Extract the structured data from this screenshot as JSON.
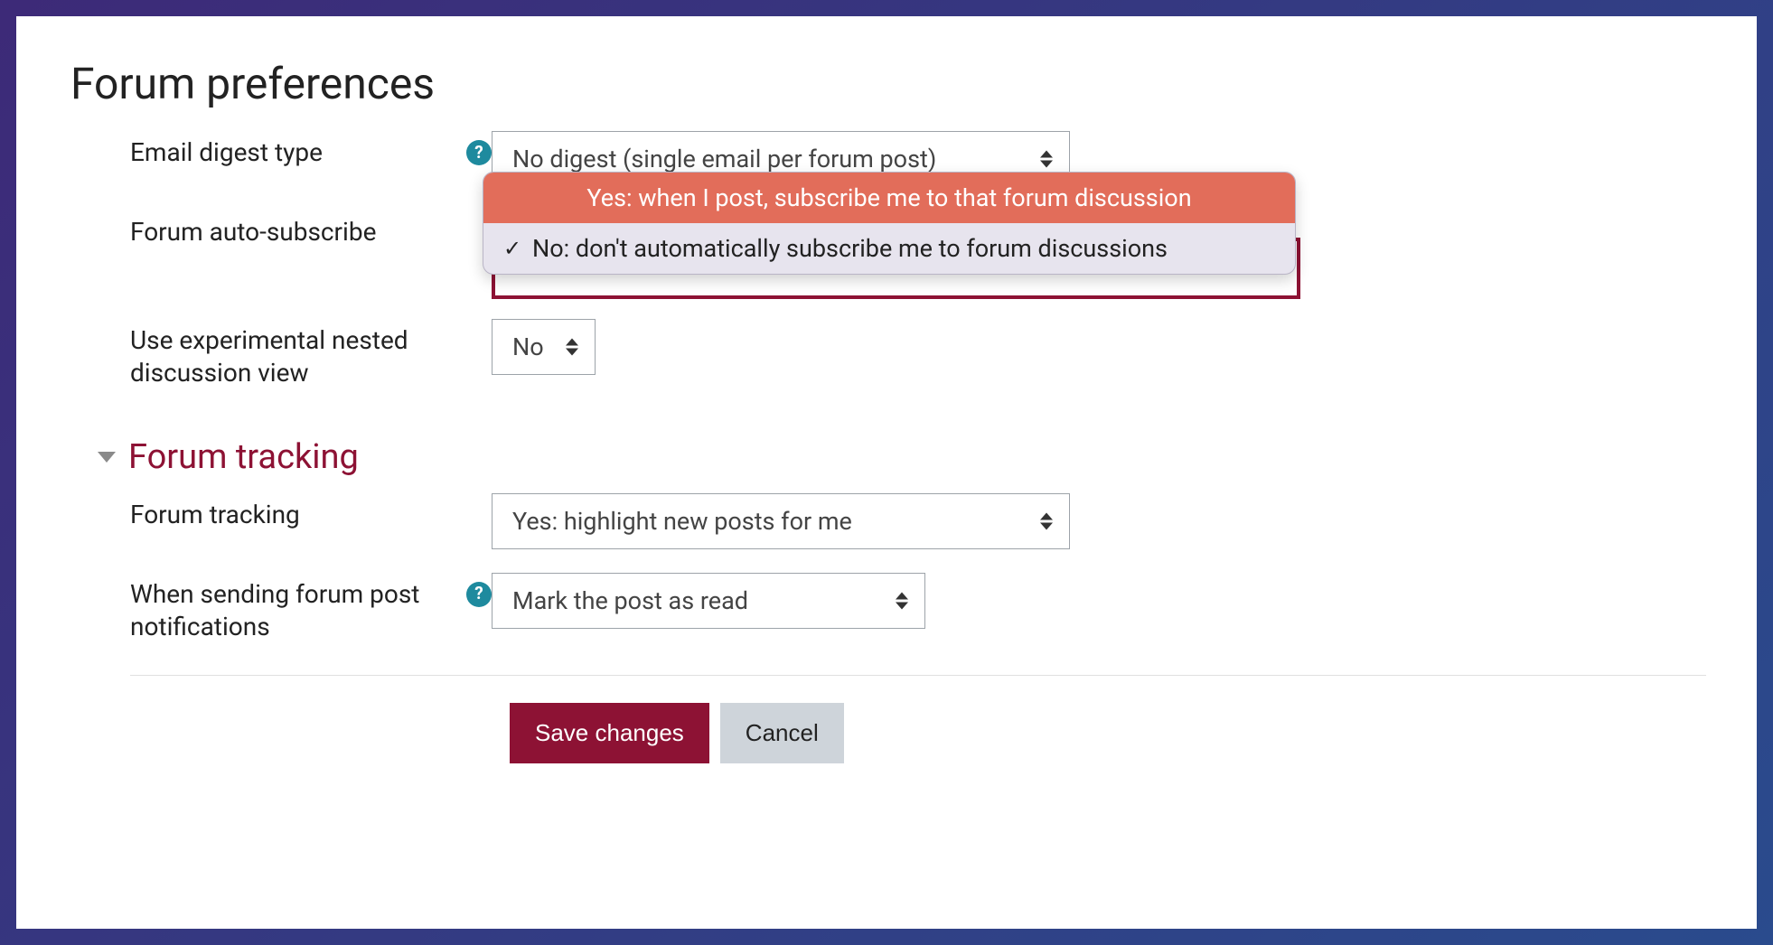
{
  "page": {
    "title": "Forum preferences"
  },
  "prefs": {
    "email_digest": {
      "label": "Email digest type",
      "help": "?",
      "value": "No digest (single email per forum post)"
    },
    "auto_subscribe": {
      "label": "Forum auto-subscribe",
      "selected": "No: don't automatically subscribe me to forum discussions",
      "options": {
        "yes": "Yes: when I post, subscribe me to that forum discussion",
        "no": "No: don't automatically subscribe me to forum discussions"
      },
      "checkmark": "✓"
    },
    "nested_view": {
      "label": "Use experimental nested discussion view",
      "value": "No"
    }
  },
  "tracking": {
    "section_title": "Forum tracking",
    "forum_tracking": {
      "label": "Forum tracking",
      "value": "Yes: highlight new posts for me"
    },
    "notifications": {
      "label": "When sending forum post notifications",
      "help": "?",
      "value": "Mark the post as read"
    }
  },
  "actions": {
    "save": "Save changes",
    "cancel": "Cancel"
  }
}
